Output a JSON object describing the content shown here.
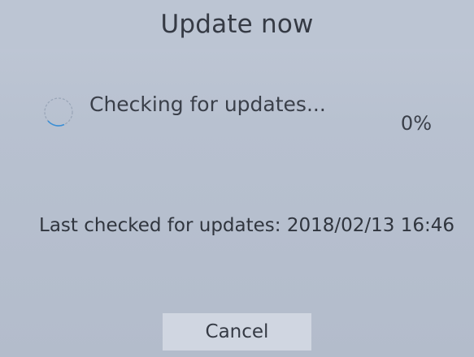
{
  "dialog": {
    "title": "Update now",
    "status": {
      "text": "Checking for updates...",
      "percent_label": "0%",
      "progress": 0,
      "icon": "spinner-icon"
    },
    "last_checked": "Last checked for updates: 2018/02/13 16:46",
    "cancel_label": "Cancel"
  },
  "colors": {
    "background": "#b8c1d0",
    "title_bar": "#bcc5d3",
    "button": "#d0d6e1",
    "spinner_accent": "#3b8fd6"
  }
}
